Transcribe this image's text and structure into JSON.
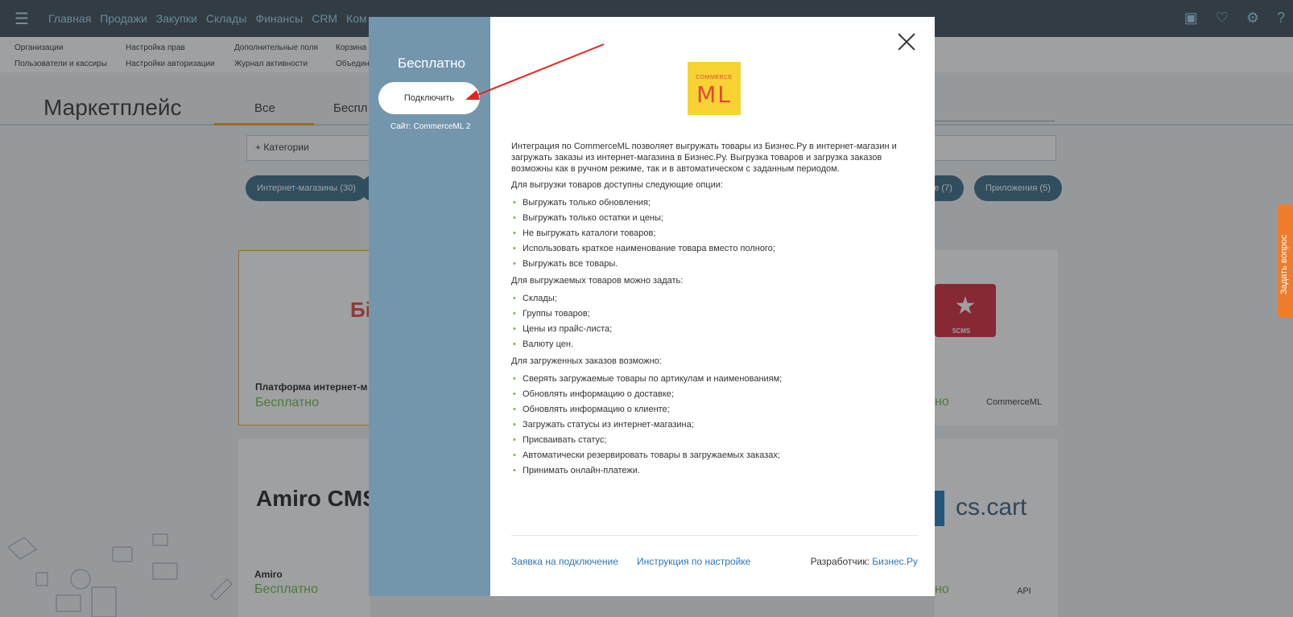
{
  "topbar": {
    "menu": [
      "Главная",
      "Продажи",
      "Закупки",
      "Склады",
      "Финансы",
      "CRM",
      "Ком"
    ]
  },
  "subnav": {
    "col1": [
      "Организации",
      "Пользователи и кассиры"
    ],
    "col2": [
      "Настройка прав",
      "Настройки авторизации"
    ],
    "col3": [
      "Дополнительные поля",
      "Журнал активности"
    ],
    "col4": [
      "Корзина",
      "Объедин"
    ]
  },
  "marketplace": {
    "title": "Маркетплейс",
    "tab_all": "Все",
    "tab_free": "Беспл",
    "categories": "Категории",
    "chips": [
      "Интернет-магазины (30)",
      "ное (7)",
      "Приложения (5)"
    ]
  },
  "cards": [
    {
      "logo": "Бі",
      "name": "Платформа интернет-м",
      "price": "Бесплатно"
    },
    {
      "logo": "5CMS",
      "price": "но",
      "tag": "CommerceML"
    },
    {
      "logo": "Amiro CMS",
      "name": "Amiro",
      "price": "Бесплатно"
    },
    {
      "logo": "cs.cart",
      "price": "но",
      "tag": "API"
    }
  ],
  "ask_tab": "Задать вопрос",
  "modal": {
    "side_title": "Бесплатно",
    "connect_button": "Подключить",
    "site_link": "Сайт: CommerceML 2",
    "logo_small": "COMMERCE",
    "logo_big": "ML",
    "intro": "Интеграция по CommerceML позволяет выгружать товары из Бизнес.Ру в интернет-магазин и загружать заказы из интернет-магазина в Бизнес.Ру. Выгрузка товаров и загрузка заказов возможны как в ручном режиме, так и в автоматическом с заданным периодом.",
    "section1_title": "Для выгрузки товаров доступны следующие опции:",
    "section1_items": [
      "Выгружать только обновления;",
      "Выгружать только остатки и цены;",
      "Не выгружать каталоги товаров;",
      "Использовать краткое наименование товара вместо полного;",
      "Выгружать все товары."
    ],
    "section2_title": "Для выгружаемых товаров можно задать:",
    "section2_items": [
      "Склады;",
      "Группы товаров;",
      "Цены из прайс-листа;",
      "Валюту цен."
    ],
    "section3_title": "Для загруженных заказов возможно:",
    "section3_items": [
      "Сверять загружаемые товары по артикулам и наименованиям;",
      "Обновлять информацию о доставке;",
      "Обновлять информацию о клиенте;",
      "Загружать статусы из интернет-магазина;",
      "Присваивать статус;",
      "Автоматически резервировать товары в загружаемых заказах;",
      "Принимать онлайн-платежи."
    ],
    "footer": {
      "request_link": "Заявка на подключение",
      "instruction_link": "Инструкция по настройке",
      "developer_label": "Разработчик:",
      "developer_link": "Бизнес.Ру"
    }
  },
  "colors": {
    "side_panel": "#7496ad",
    "accent_green": "#6dbb3c",
    "link_blue": "#2a78b8",
    "annotation_arrow": "#e8211b"
  }
}
